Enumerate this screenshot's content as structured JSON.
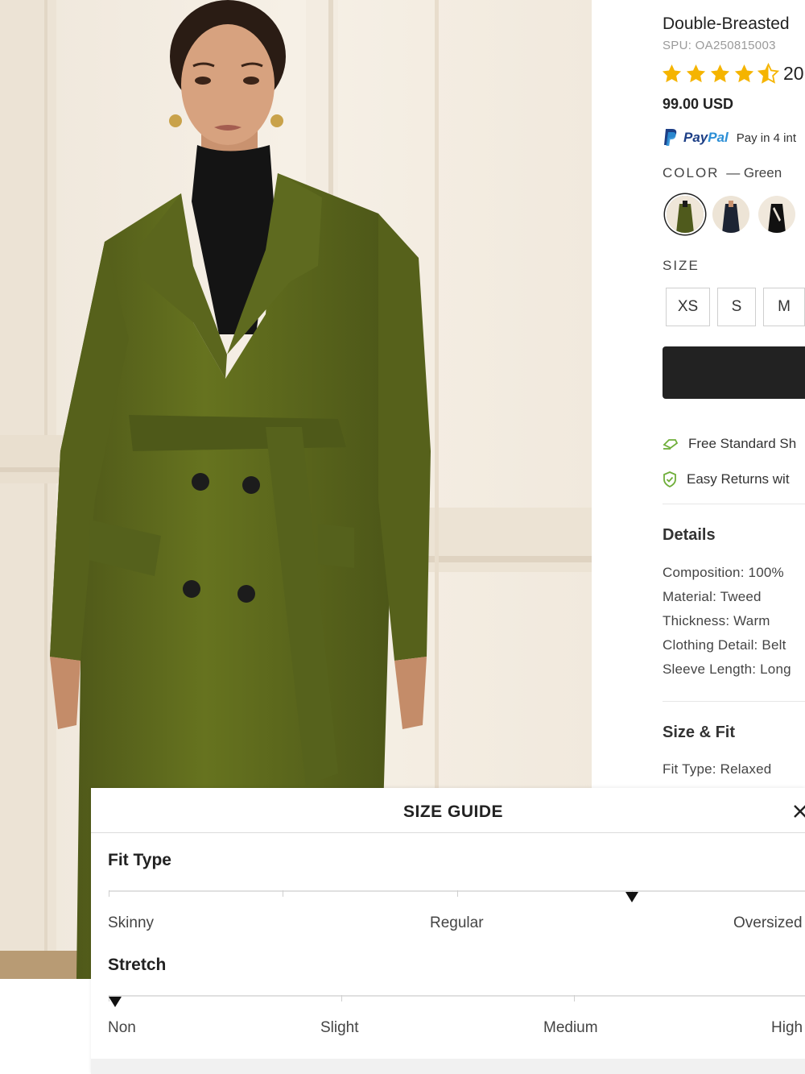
{
  "product": {
    "title": "Double-Breasted",
    "spu": "SPU: OA250815003",
    "rating": 4.5,
    "review_count": "20",
    "price": "99.00 USD",
    "paypal": {
      "logo_word_a": "Pay",
      "logo_word_b": "Pal",
      "text": "Pay in 4 int"
    },
    "color": {
      "label": "COLOR",
      "value": "— Green",
      "swatches": [
        {
          "name": "green",
          "color": "#4f5a1c",
          "selected": true
        },
        {
          "name": "navy",
          "color": "#1d2433",
          "selected": false
        },
        {
          "name": "black",
          "color": "#111111",
          "selected": false
        }
      ]
    },
    "size": {
      "label": "SIZE",
      "options": [
        "XS",
        "S",
        "M"
      ]
    },
    "perks": [
      {
        "icon": "shipping-icon",
        "text": "Free Standard Sh"
      },
      {
        "icon": "shield-check-icon",
        "text": "Easy Returns wit"
      }
    ],
    "details": {
      "heading": "Details",
      "items": [
        "Composition: 100%",
        "Material: Tweed",
        "Thickness: Warm",
        "Clothing Detail: Belt",
        "Sleeve Length: Long"
      ]
    },
    "size_fit": {
      "heading": "Size & Fit",
      "fit_type": "Fit Type: Relaxed"
    }
  },
  "size_guide": {
    "title": "SIZE GUIDE",
    "close_icon": "close-icon",
    "fit_type": {
      "heading": "Fit Type",
      "labels": [
        "Skinny",
        "Regular",
        "Oversized"
      ],
      "level": 0.75
    },
    "stretch": {
      "heading": "Stretch",
      "labels": [
        "Non",
        "Slight",
        "Medium",
        "High"
      ],
      "level": 0.0
    }
  },
  "colors": {
    "accent_green": "#9bc23c",
    "star": "#f5b400",
    "paypal_dark": "#1d3f86",
    "paypal_light": "#2c8fd6",
    "button_dark": "#222222"
  }
}
